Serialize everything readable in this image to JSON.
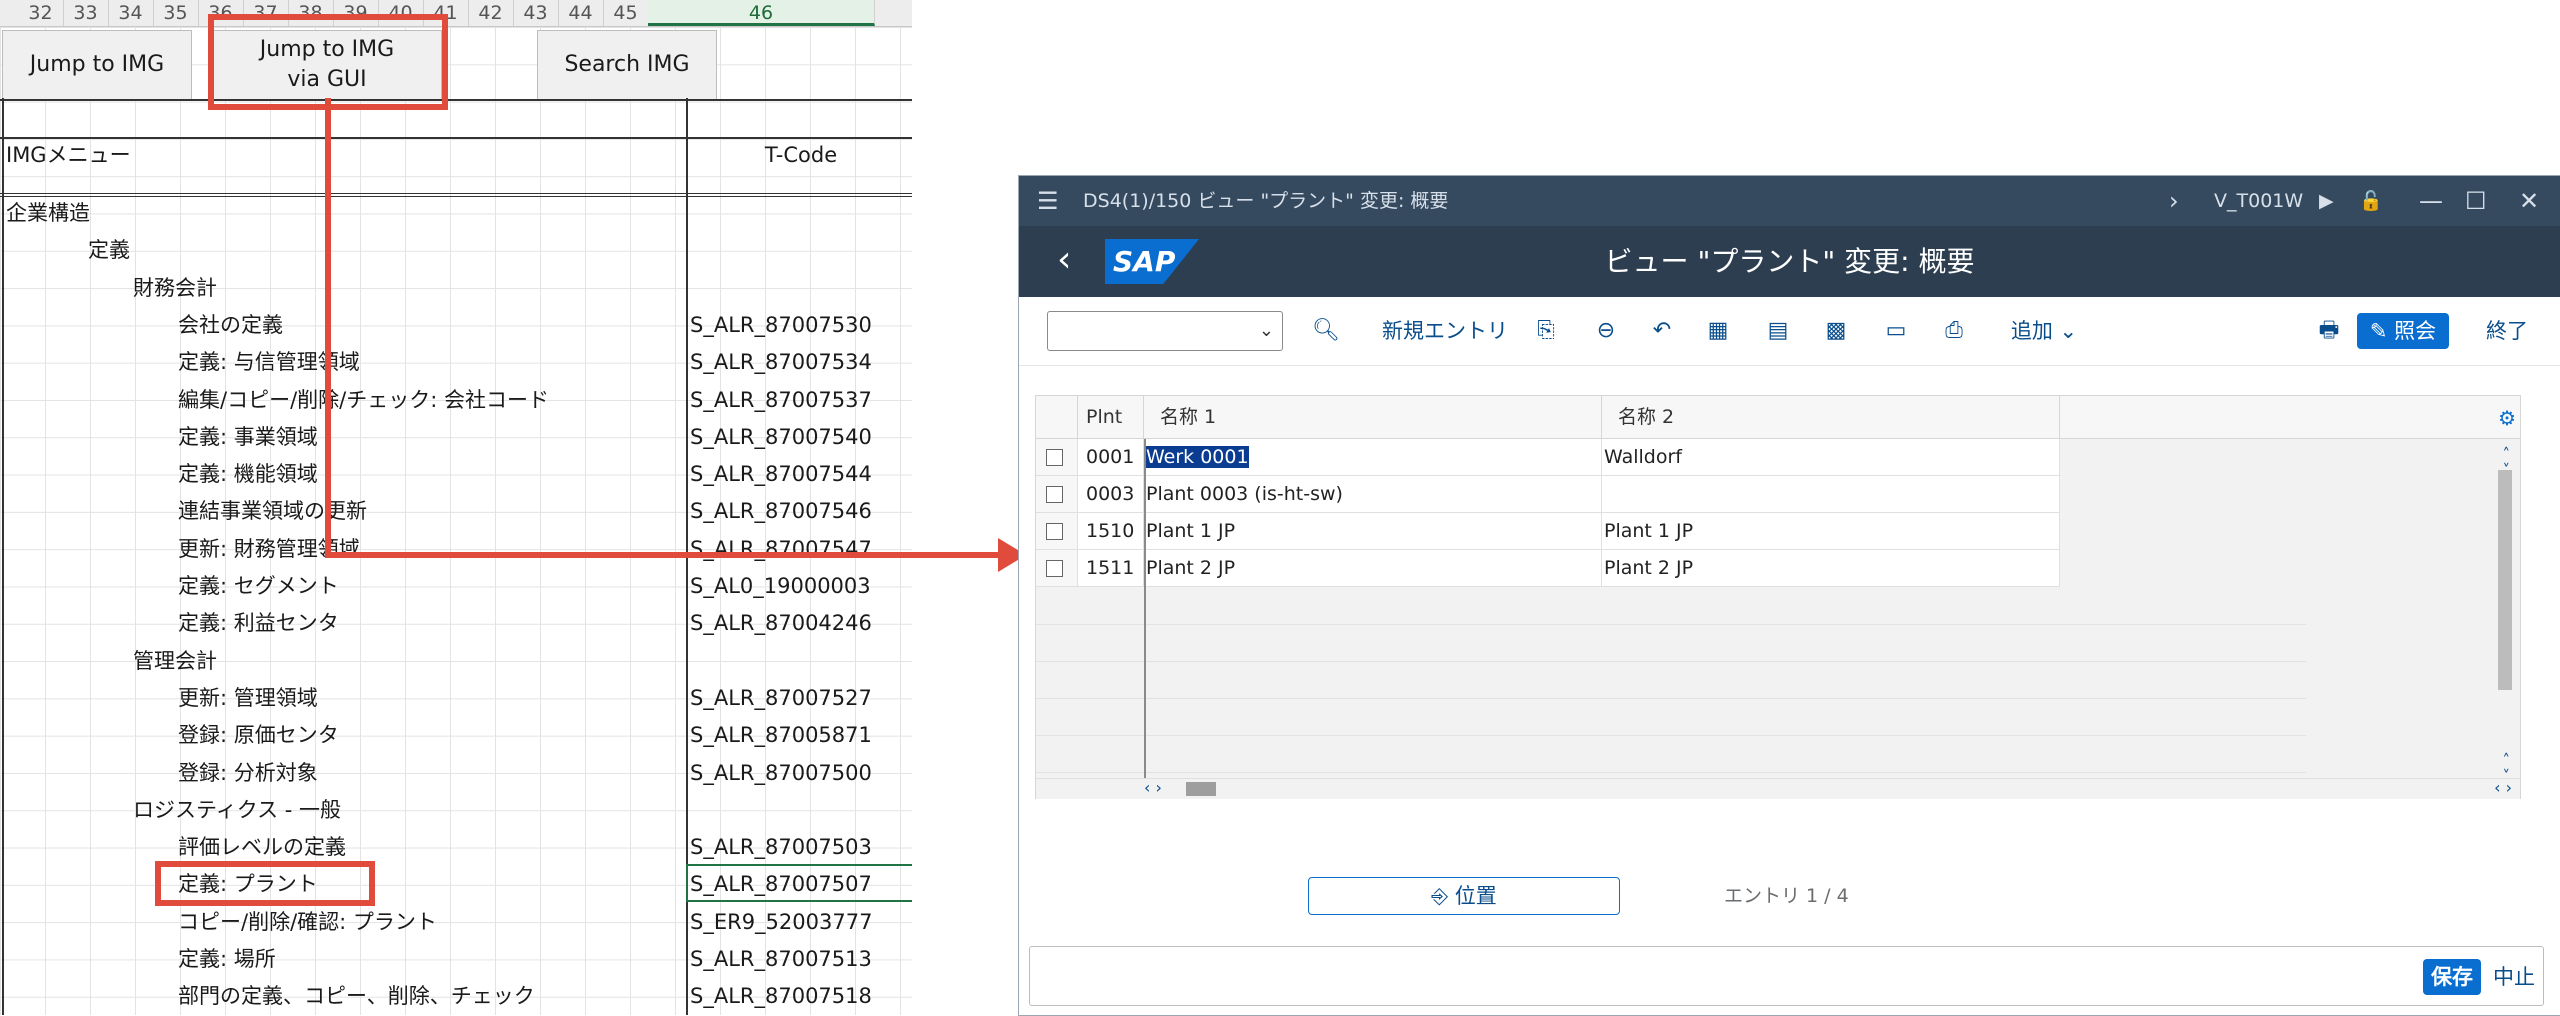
{
  "sheet": {
    "columns": [
      "32",
      "33",
      "34",
      "35",
      "36",
      "37",
      "38",
      "39",
      "40",
      "41",
      "42",
      "43",
      "44",
      "45",
      "46"
    ],
    "buttons": {
      "jump": "Jump to IMG",
      "jump_gui_line1": "Jump to IMG",
      "jump_gui_line2": "via GUI",
      "search": "Search IMG"
    },
    "header": {
      "menu": "IMGメニュー",
      "tcode": "T-Code"
    },
    "rows": [
      {
        "label": "企業構造",
        "indent": 0,
        "code": ""
      },
      {
        "label": "定義",
        "indent": 1,
        "code": ""
      },
      {
        "label": "財務会計",
        "indent": 2,
        "code": ""
      },
      {
        "label": "会社の定義",
        "indent": 3,
        "code": "S_ALR_87007530"
      },
      {
        "label": "定義: 与信管理領域",
        "indent": 3,
        "code": "S_ALR_87007534"
      },
      {
        "label": "編集/コピー/削除/チェック: 会社コード",
        "indent": 3,
        "code": "S_ALR_87007537"
      },
      {
        "label": "定義: 事業領域",
        "indent": 3,
        "code": "S_ALR_87007540"
      },
      {
        "label": "定義: 機能領域",
        "indent": 3,
        "code": "S_ALR_87007544"
      },
      {
        "label": "連結事業領域の更新",
        "indent": 3,
        "code": "S_ALR_87007546"
      },
      {
        "label": "更新: 財務管理領域",
        "indent": 3,
        "code": "S_ALR_87007547"
      },
      {
        "label": "定義: セグメント",
        "indent": 3,
        "code": "S_AL0_19000003"
      },
      {
        "label": "定義: 利益センタ",
        "indent": 3,
        "code": "S_ALR_87004246"
      },
      {
        "label": "管理会計",
        "indent": 2,
        "code": ""
      },
      {
        "label": "更新: 管理領域",
        "indent": 3,
        "code": "S_ALR_87007527"
      },
      {
        "label": "登録: 原価センタ",
        "indent": 3,
        "code": "S_ALR_87005871"
      },
      {
        "label": "登録: 分析対象",
        "indent": 3,
        "code": "S_ALR_87007500"
      },
      {
        "label": "ロジスティクス - 一般",
        "indent": 2,
        "code": ""
      },
      {
        "label": "評価レベルの定義",
        "indent": 3,
        "code": "S_ALR_87007503"
      },
      {
        "label": "定義: プラント",
        "indent": 3,
        "code": "S_ALR_87007507"
      },
      {
        "label": "コピー/削除/確認: プラント",
        "indent": 3,
        "code": "S_ER9_52003777"
      },
      {
        "label": "定義: 場所",
        "indent": 3,
        "code": "S_ALR_87007513"
      },
      {
        "label": "部門の定義、コピー、削除、チェック",
        "indent": 3,
        "code": "S_ALR_87007518"
      }
    ]
  },
  "sap": {
    "window_title": "DS4(1)/150 ビュー \"プラント\" 変更: 概要",
    "transaction": "V_T001W",
    "logo": "SAP",
    "page_title": "ビュー \"プラント\" 変更: 概要",
    "toolbar": {
      "new_entry": "新規エントリ",
      "more": "追加",
      "display": "照会",
      "exit": "終了"
    },
    "table": {
      "headers": [
        "Plnt",
        "名称 1",
        "名称 2"
      ],
      "rows": [
        {
          "plnt": "0001",
          "name1": "Werk 0001",
          "name2": "Walldorf"
        },
        {
          "plnt": "0003",
          "name1": "Plant 0003 (is-ht-sw)",
          "name2": ""
        },
        {
          "plnt": "1510",
          "name1": "Plant 1 JP",
          "name2": "Plant 1 JP"
        },
        {
          "plnt": "1511",
          "name1": "Plant 2 JP",
          "name2": "Plant 2 JP"
        }
      ]
    },
    "position_button": "位置",
    "entry_count": "エントリ 1 / 4",
    "save": "保存",
    "cancel": "中止"
  },
  "colors": {
    "annotation_red": "#e04b3c",
    "sap_header": "#354a5f",
    "sap_blue": "#0a6ed1",
    "excel_green": "#217346"
  }
}
